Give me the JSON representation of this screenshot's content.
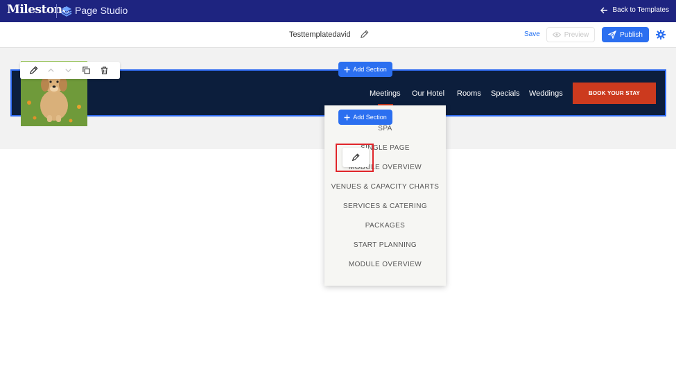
{
  "app": {
    "brand": "Milestone",
    "product": "Page Studio",
    "back_label": "Back to Templates"
  },
  "titlebar": {
    "template_name": "Testtemplatedavid",
    "save_label": "Save",
    "preview_label": "Preview",
    "publish_label": "Publish"
  },
  "canvas": {
    "add_section_label": "Add Section",
    "add_section_label_2": "Add Section",
    "nav": [
      "Meetings",
      "Our Hotel",
      "Rooms",
      "Specials",
      "Weddings"
    ],
    "book_label": "BOOK YOUR STAY"
  },
  "dropdown": {
    "items": [
      "SPA",
      "SINGLE PAGE",
      "MODULE OVERVIEW",
      "VENUES & CAPACITY CHARTS",
      "SERVICES & CATERING",
      "PACKAGES",
      "START PLANNING",
      "MODULE OVERVIEW"
    ]
  },
  "colors": {
    "appbar": "#1e2480",
    "accent": "#2b6ff0",
    "header_bg": "#0c1e3c",
    "book_button": "#cc3a1e",
    "highlight": "#e0252a"
  }
}
